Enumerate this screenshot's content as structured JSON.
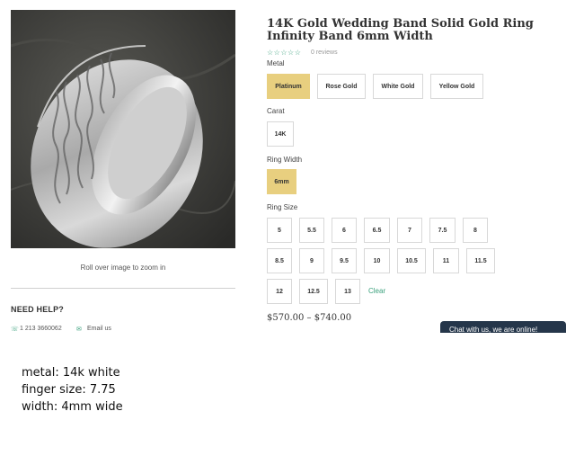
{
  "product": {
    "title": "14K Gold Wedding Band Solid Gold Ring Infinity Band 6mm Width",
    "stars": "☆☆☆☆☆",
    "reviews": "0 reviews",
    "zoom_hint": "Roll over image to zoom in",
    "price": "$570.00 – $740.00"
  },
  "options": {
    "metal": {
      "label": "Metal",
      "choices": [
        "Platinum",
        "Rose Gold",
        "White Gold",
        "Yellow Gold"
      ],
      "selected": "Platinum"
    },
    "carat": {
      "label": "Carat",
      "choices": [
        "14K"
      ],
      "selected": ""
    },
    "ring_width": {
      "label": "Ring Width",
      "choices": [
        "6mm"
      ],
      "selected": "6mm"
    },
    "ring_size": {
      "label": "Ring Size",
      "rows": [
        [
          "5",
          "5.5",
          "6",
          "6.5",
          "7",
          "7.5",
          "8"
        ],
        [
          "8.5",
          "9",
          "9.5",
          "10",
          "10.5",
          "11",
          "11.5"
        ],
        [
          "12",
          "12.5",
          "13"
        ]
      ],
      "clear_label": "Clear"
    }
  },
  "help": {
    "title": "NEED HELP?",
    "phone": "1 213 3660062",
    "email": "Email us"
  },
  "chat": {
    "label": "Chat with us, we are online!"
  },
  "notes": {
    "line1": "metal: 14k white",
    "line2": "finger size: 7.75",
    "line3": "width: 4mm wide"
  },
  "colors": {
    "accent_green": "#3aa07c",
    "selected_gold": "#e8cf7f",
    "chat_bg": "#25364a"
  }
}
